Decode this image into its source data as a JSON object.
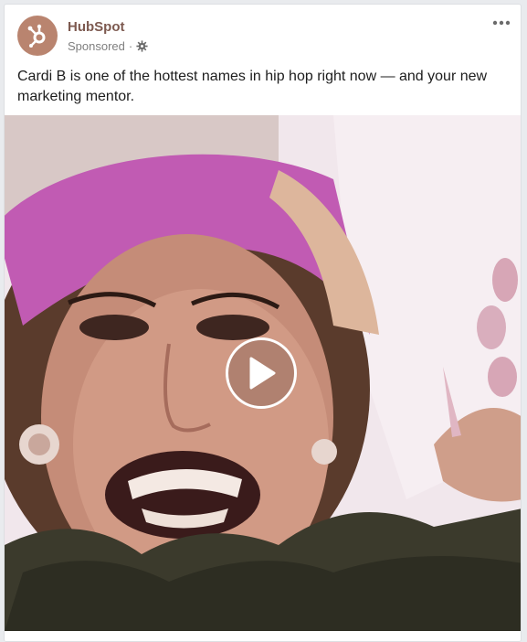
{
  "post": {
    "page_name": "HubSpot",
    "sponsored_label": "Sponsored",
    "separator": "·",
    "caption": "Cardi B is one of the hottest names in hip hop right now — and your new marketing mentor."
  },
  "icons": {
    "avatar": "hubspot-logo-icon",
    "audience": "gear-icon",
    "more": "more-options-icon",
    "play": "play-icon"
  },
  "colors": {
    "page_name": "#7d5a50",
    "avatar_bg": "#b9846f",
    "muted_text": "#7f7f7f",
    "caption_text": "#1d1d1d"
  }
}
